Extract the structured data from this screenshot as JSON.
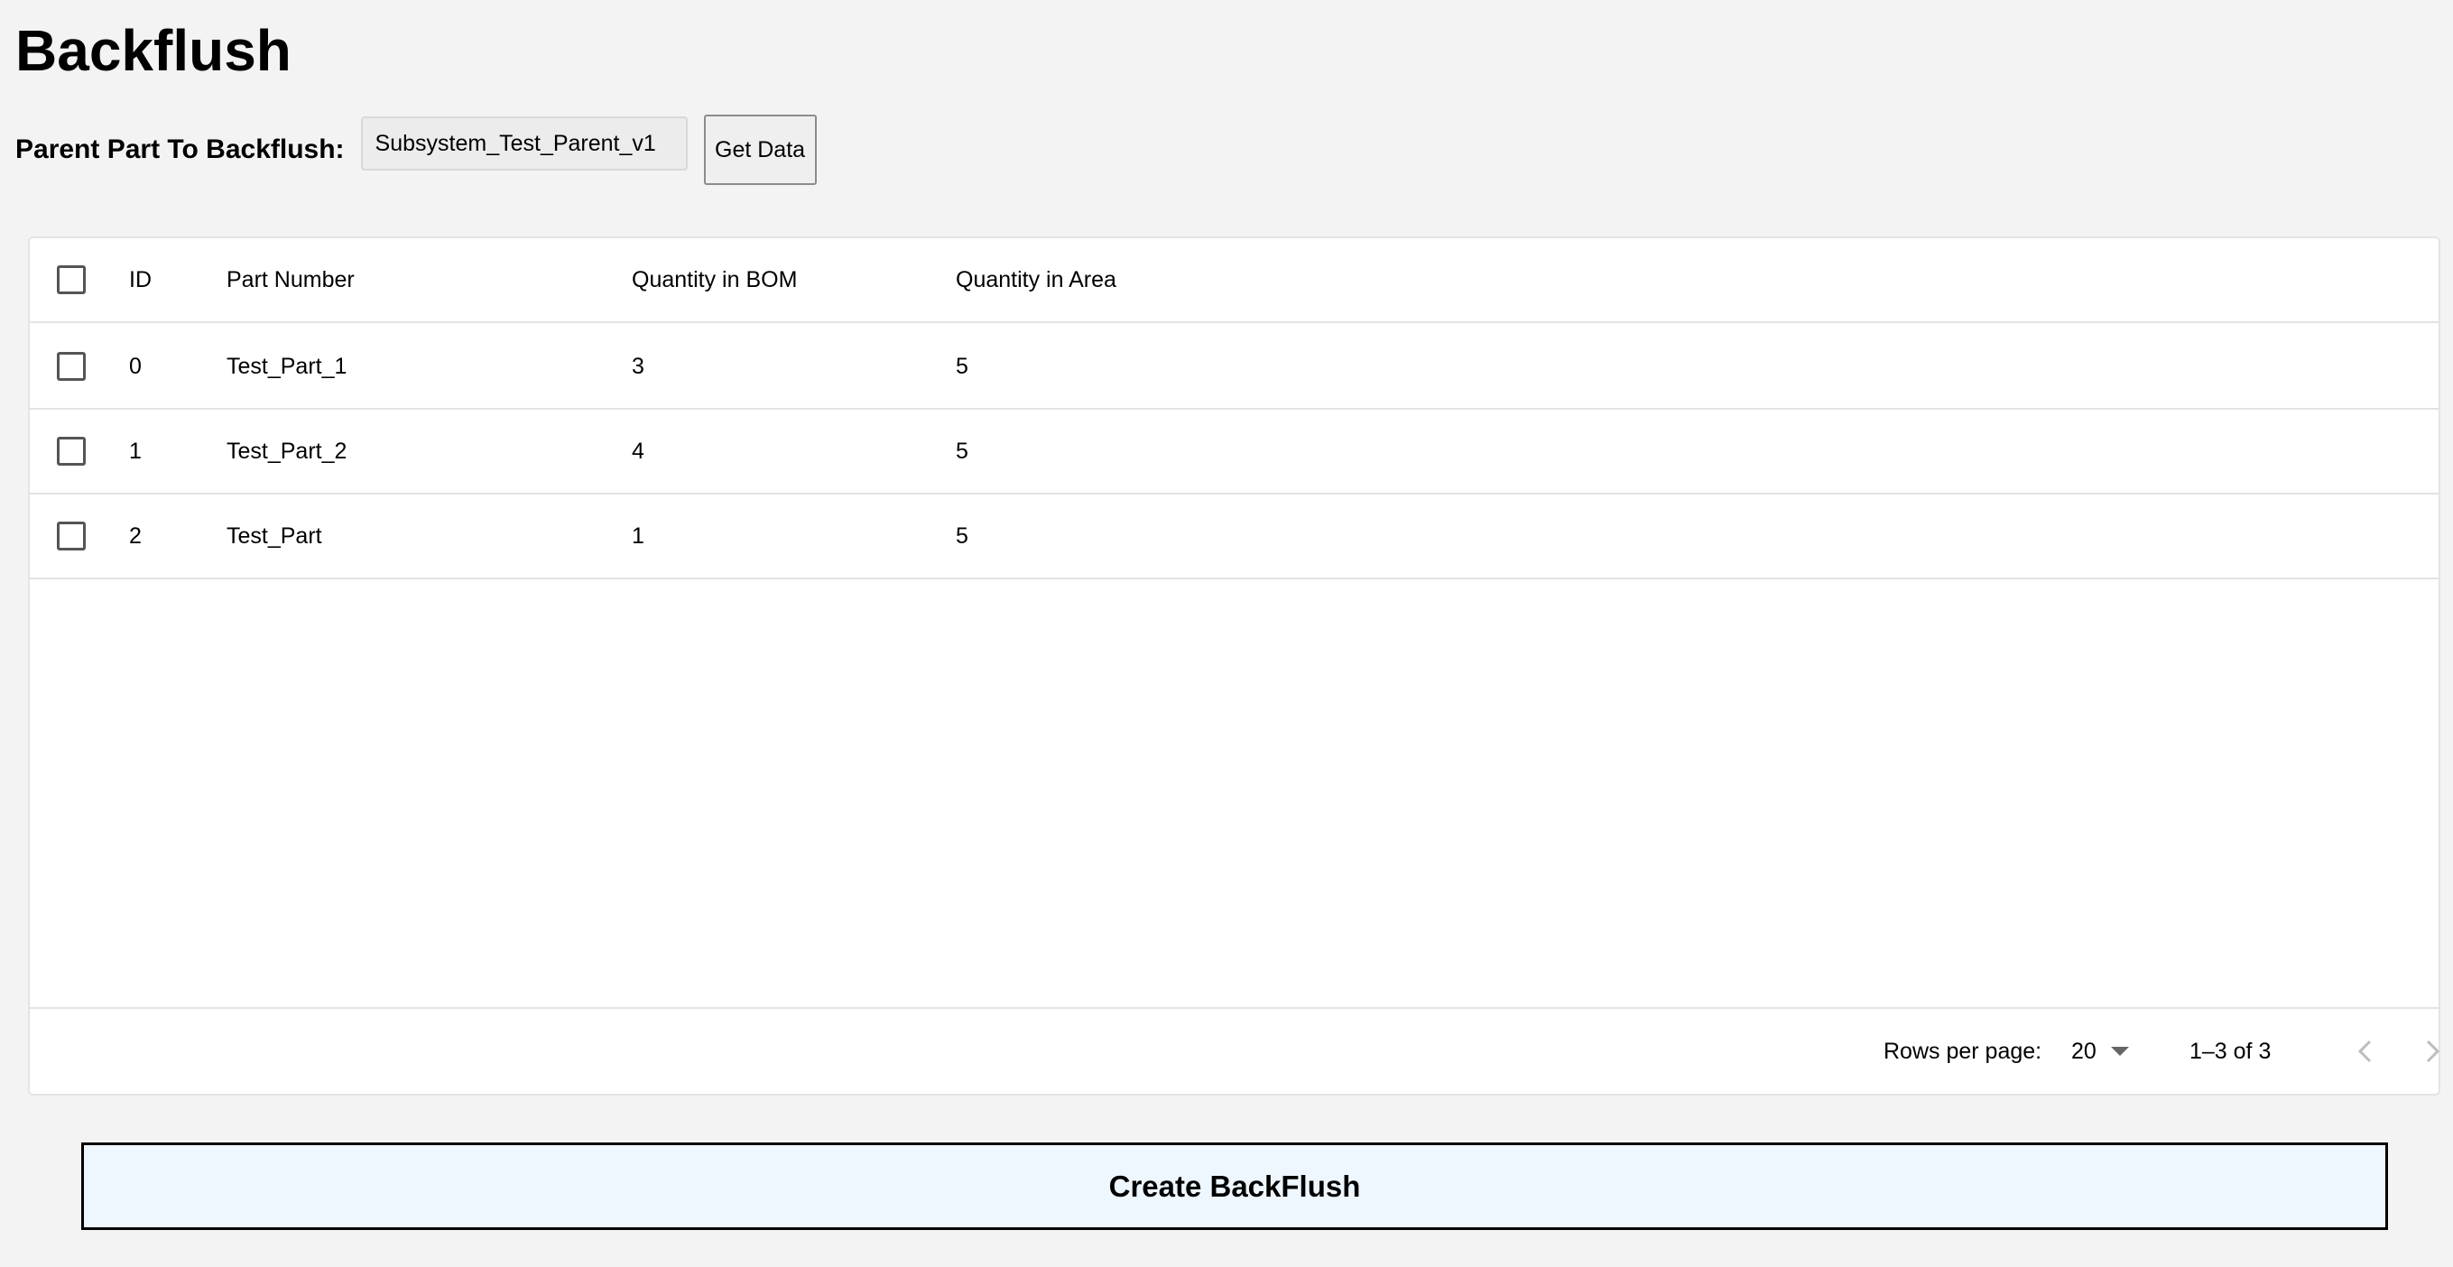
{
  "page": {
    "title": "Backflush"
  },
  "parent_part": {
    "label": "Parent Part To Backflush:",
    "value": "Subsystem_Test_Parent_v1",
    "get_data_label": "Get Data"
  },
  "table": {
    "columns": {
      "id": "ID",
      "part_number": "Part Number",
      "qty_bom": "Quantity in BOM",
      "qty_area": "Quantity in Area"
    },
    "rows": [
      {
        "id": "0",
        "part_number": "Test_Part_1",
        "qty_bom": "3",
        "qty_area": "5",
        "checked": false
      },
      {
        "id": "1",
        "part_number": "Test_Part_2",
        "qty_bom": "4",
        "qty_area": "5",
        "checked": false
      },
      {
        "id": "2",
        "part_number": "Test_Part",
        "qty_bom": "1",
        "qty_area": "5",
        "checked": false
      }
    ],
    "footer": {
      "rows_per_page_label": "Rows per page:",
      "rows_per_page_value": "20",
      "range_text": "1–3 of 3"
    }
  },
  "actions": {
    "create_label": "Create BackFlush"
  },
  "icons": {
    "prev": "chevron-left-icon",
    "next": "chevron-right-icon",
    "dropdown": "caret-down-icon"
  },
  "colors": {
    "background": "#f3f3f3",
    "create_button_bg": "#eef6fe"
  }
}
